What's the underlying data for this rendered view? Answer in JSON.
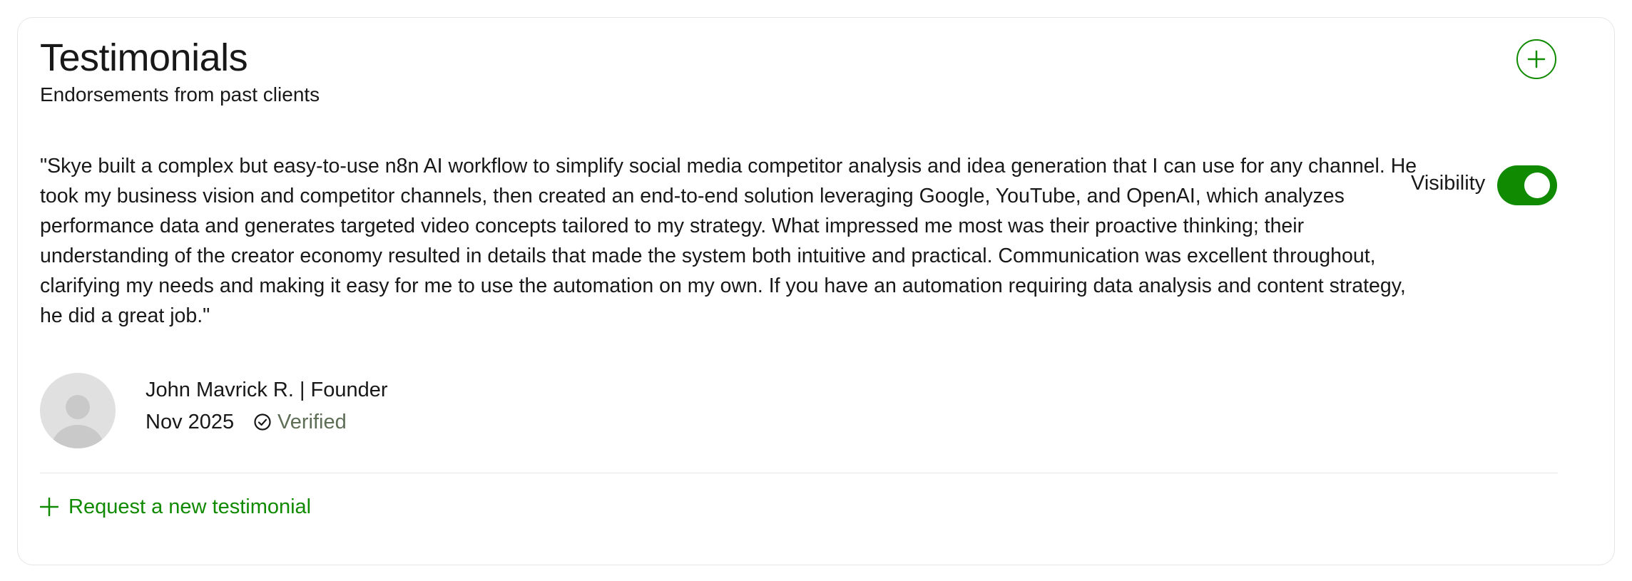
{
  "section": {
    "title": "Testimonials",
    "subtitle": "Endorsements from past clients",
    "add_icon": "plus-circle-icon"
  },
  "testimonial": {
    "quote": "\"Skye built a complex but easy-to-use n8n AI workflow to simplify social media competitor analysis and idea generation that I can use for any channel. He took my business vision and competitor channels, then created an end-to-end solution leveraging Google, YouTube, and OpenAI, which analyzes performance data and generates targeted video concepts tailored to my strategy. What impressed me most was their proactive thinking; their understanding of the creator economy resulted in details that made the system both intuitive and practical. Communication was excellent throughout, clarifying my needs and making it easy for me to use the automation on my own. If you have an automation requiring data analysis and content strategy, he did a great job.\"",
    "visibility_label": "Visibility",
    "visibility_on": true,
    "author": "John Mavrick R. | Founder",
    "date": "Nov 2025",
    "verified_label": "Verified",
    "verified_icon": "check-circle-icon",
    "avatar_icon": "user-avatar-icon"
  },
  "footer": {
    "request_label": "Request a new testimonial",
    "request_icon": "plus-icon"
  },
  "colors": {
    "accent": "#108a00",
    "border": "#e4e6e4",
    "text": "#181818",
    "muted": "#5e6d55",
    "avatar_bg": "#e0e0e0"
  }
}
